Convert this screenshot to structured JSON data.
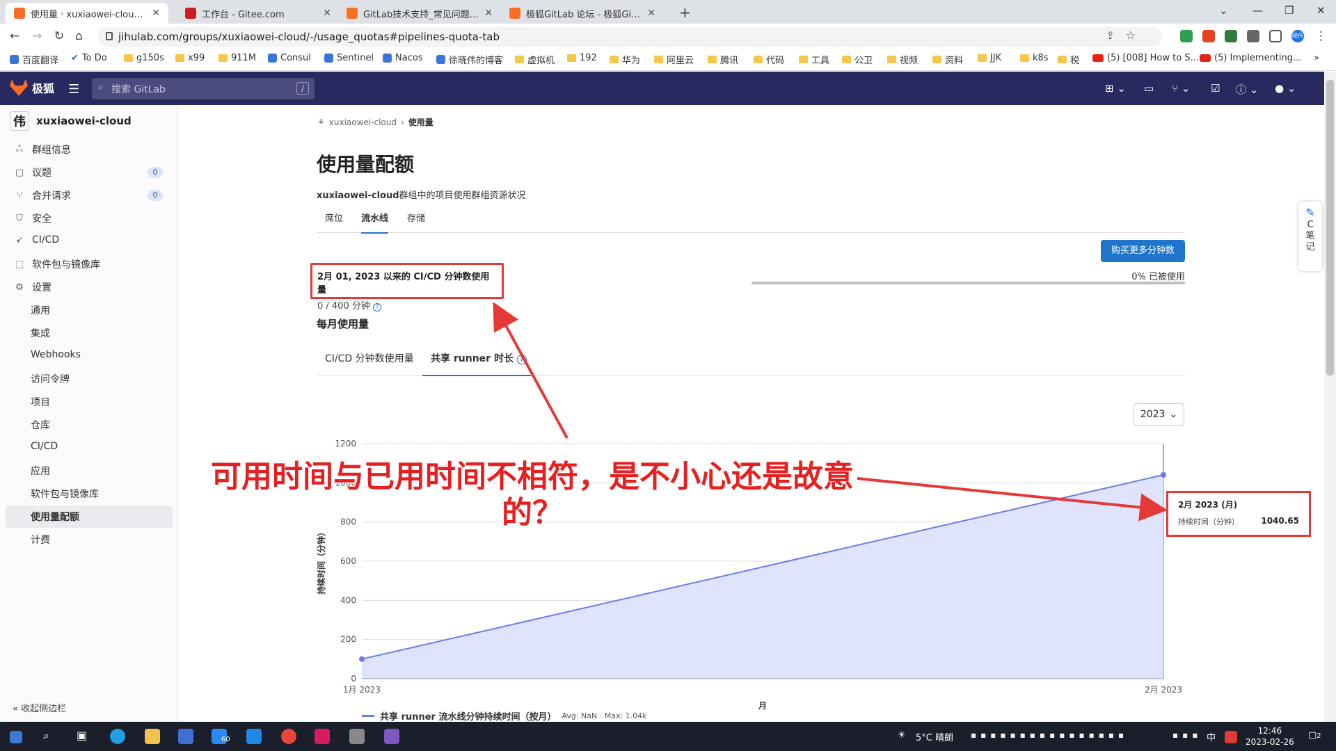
{
  "browser": {
    "tabs": [
      {
        "title": "使用量 · xuxiaowei-cloud · 极狐",
        "color": "#fc6d26",
        "active": true
      },
      {
        "title": "工作台 - Gitee.com",
        "color": "#c71d23",
        "active": false
      },
      {
        "title": "GitLab技术支持_常见问题-极狐G",
        "color": "#fc6d26",
        "active": false
      },
      {
        "title": "极狐GitLab 论坛 - 极狐GitLab 论",
        "color": "#fc6d26",
        "active": false
      }
    ],
    "url": "jihulab.com/groups/xuxiaowei-cloud/-/usage_quotas#pipelines-quota-tab",
    "profile_label": "晓伟"
  },
  "bookmarks": [
    {
      "label": "百度翻译",
      "kind": "app"
    },
    {
      "label": "To Do",
      "kind": "check"
    },
    {
      "label": "g150s",
      "kind": "folder"
    },
    {
      "label": "x99",
      "kind": "folder"
    },
    {
      "label": "911M",
      "kind": "folder"
    },
    {
      "label": "Consul",
      "kind": "app"
    },
    {
      "label": "Sentinel",
      "kind": "app"
    },
    {
      "label": "Nacos",
      "kind": "app"
    },
    {
      "label": "徐晓伟的博客",
      "kind": "app"
    },
    {
      "label": "虚拟机",
      "kind": "folder"
    },
    {
      "label": "192",
      "kind": "folder"
    },
    {
      "label": "华为",
      "kind": "folder"
    },
    {
      "label": "阿里云",
      "kind": "folder"
    },
    {
      "label": "腾讯",
      "kind": "folder"
    },
    {
      "label": "代码",
      "kind": "folder"
    },
    {
      "label": "工具",
      "kind": "folder"
    },
    {
      "label": "公卫",
      "kind": "folder"
    },
    {
      "label": "视频",
      "kind": "folder"
    },
    {
      "label": "资料",
      "kind": "folder"
    },
    {
      "label": "JJK",
      "kind": "folder"
    },
    {
      "label": "k8s",
      "kind": "folder"
    },
    {
      "label": "税",
      "kind": "folder"
    },
    {
      "label": "(5) [008] How to S...",
      "kind": "youtube"
    },
    {
      "label": "(5) Implementing...",
      "kind": "youtube"
    }
  ],
  "gitlab": {
    "brand": "极狐",
    "search_placeholder": "搜索 GitLab",
    "search_kbd": "/"
  },
  "sidebar": {
    "group_name": "xuxiaowei-cloud",
    "group_avatar": "伟",
    "items": [
      {
        "label": "群组信息",
        "icon": "info-icon"
      },
      {
        "label": "议题",
        "icon": "issues-icon",
        "badge": "0"
      },
      {
        "label": "合并请求",
        "icon": "merge-request-icon",
        "badge": "0"
      },
      {
        "label": "安全",
        "icon": "shield-icon"
      },
      {
        "label": "CI/CD",
        "icon": "rocket-icon"
      },
      {
        "label": "软件包与镜像库",
        "icon": "package-icon"
      },
      {
        "label": "设置",
        "icon": "settings-icon"
      }
    ],
    "sub_items": [
      "通用",
      "集成",
      "Webhooks",
      "访问令牌",
      "项目",
      "仓库",
      "CI/CD",
      "应用",
      "软件包与镜像库",
      "使用量配额",
      "计费"
    ],
    "collapse_label": "收起侧边栏"
  },
  "page": {
    "breadcrumb_group": "xuxiaowei-cloud",
    "breadcrumb_current": "使用量",
    "title": "使用量配额",
    "desc_group": "xuxiaowei-cloud",
    "desc_text": "群组中的项目使用群组资源状况",
    "tabs": [
      "席位",
      "流水线",
      "存储"
    ],
    "buy_button": "购买更多分钟数",
    "quota_title": "2月 01, 2023 以来的 CI/CD 分钟数使用量",
    "quota_value": "0 / 400 分钟",
    "used_text": "0% 已被使用",
    "used_fraction": 0,
    "monthly_title": "每月使用量",
    "subtabs": [
      "CI/CD 分钟数使用量",
      "共享 runner 时长"
    ],
    "year": "2023"
  },
  "chart_data": {
    "type": "area",
    "x": [
      "1月 2023",
      "2月 2023"
    ],
    "series": [
      {
        "name": "共享 runner 流水线分钟持续时间（按月）",
        "values": [
          100,
          1040.65
        ],
        "color": "#6b7cea"
      }
    ],
    "xlabel": "月",
    "ylabel": "持续时间（分钟）",
    "ylim": [
      0,
      1200
    ],
    "yticks": [
      "0",
      "200",
      "400",
      "600",
      "800",
      "1000",
      "1200"
    ],
    "legend_stats": "Avg: NaN · Max: 1.04k",
    "tooltip": {
      "title": "2月 2023 (月)",
      "label": "持续时间（分钟）",
      "value": "1040.65"
    }
  },
  "annotation": {
    "text": "可用时间与已用时间不相符，是不小心还是故意的？"
  },
  "side_note": "C笔记",
  "taskbar": {
    "weather": "5°C 晴朗",
    "ime": "中",
    "time": "12:46",
    "date": "2023-02-26",
    "mail_badge": "60",
    "notif": "2"
  }
}
